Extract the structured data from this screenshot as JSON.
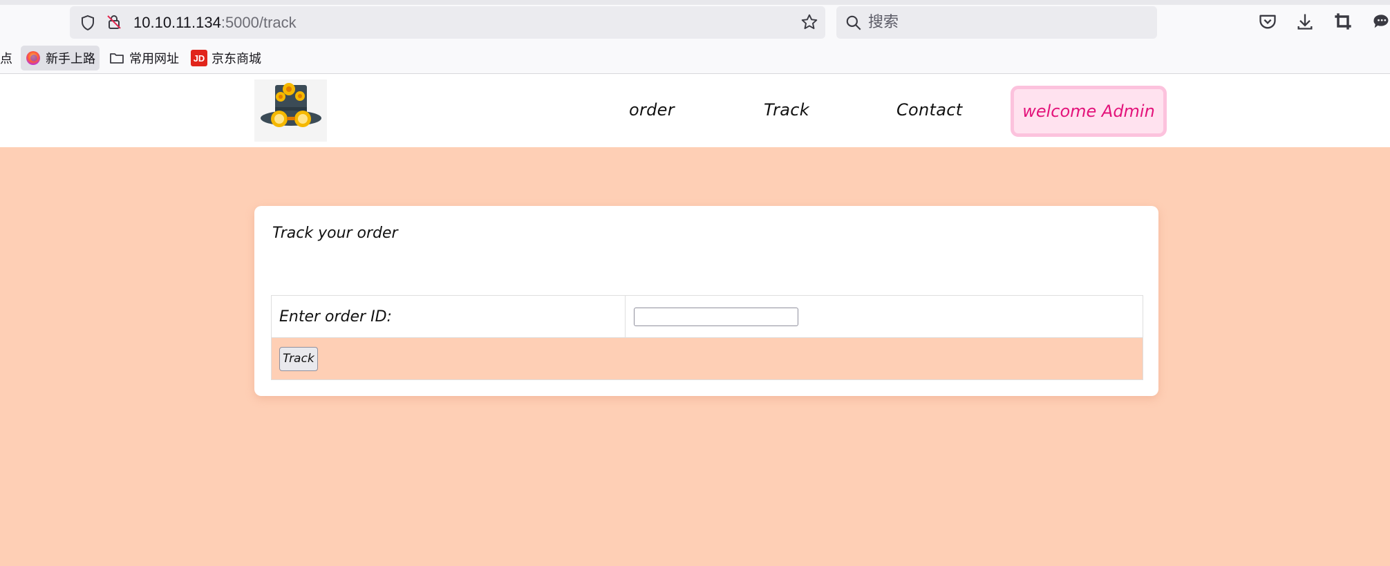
{
  "browser": {
    "url_host": "10.10.11.134",
    "url_path": ":5000/track",
    "search_placeholder": "搜索",
    "bookmarks": [
      {
        "label": "点"
      },
      {
        "label": "新手上路"
      },
      {
        "label": "常用网址"
      },
      {
        "label": "京东商城",
        "icon_text": "JD"
      }
    ]
  },
  "nav": {
    "items": [
      "order",
      "Track",
      "Contact"
    ],
    "welcome": "welcome Admin"
  },
  "card": {
    "title": "Track your order",
    "label": "Enter order ID:",
    "input_value": "",
    "button": "Track"
  },
  "colors": {
    "page_bg": "#fecfb5",
    "welcome_text": "#e3127a",
    "welcome_border": "#fcc2dd"
  }
}
